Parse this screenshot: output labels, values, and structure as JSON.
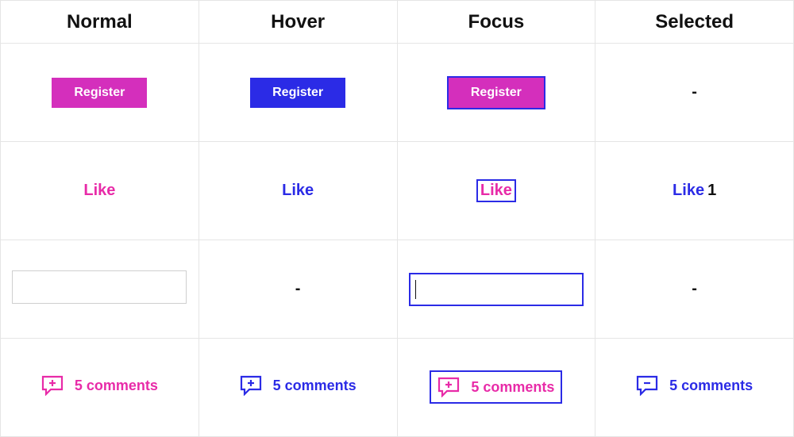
{
  "headers": [
    "Normal",
    "Hover",
    "Focus",
    "Selected"
  ],
  "colors": {
    "pink": "#e82ba8",
    "magenta_fill": "#d42fbc",
    "blue": "#2b2be6"
  },
  "rows": {
    "register": {
      "normal": "Register",
      "hover": "Register",
      "focus": "Register",
      "selected": "-"
    },
    "like": {
      "normal": "Like",
      "hover": "Like",
      "focus": "Like",
      "selected_label": "Like",
      "selected_count": "1"
    },
    "input": {
      "normal": "",
      "hover": "-",
      "focus": "",
      "selected": "-"
    },
    "comments": {
      "normal": "5 comments",
      "hover": "5 comments",
      "focus": "5 comments",
      "selected": "5 comments"
    }
  }
}
